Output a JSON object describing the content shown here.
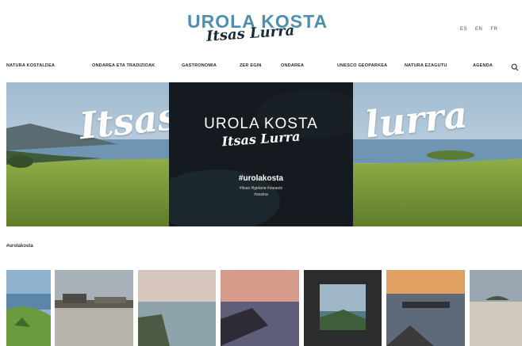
{
  "header": {
    "logo_main": "UROLA KOSTA",
    "logo_script": "Itsas Lurra",
    "languages": [
      "ES",
      "EN",
      "FR"
    ]
  },
  "nav": {
    "items": [
      "NATURA KOSTALDEA",
      "ONDAREA ETA TRADIZIOAK",
      "GASTRONOMIA",
      "ZER EGIN",
      "ONDAREA",
      "UNESCO GEOPARKEA",
      "NATURA EZAGUTU",
      "AGENDA"
    ]
  },
  "hero": {
    "word_left": "Itsas",
    "word_right": "lurra",
    "card_title": "UROLA KOSTA",
    "card_script": "Itsas Lurra",
    "hashtag": "#urolakosta",
    "tags_line1": "#itsas #lgetaria #zarautz",
    "tags_line2": "#zestoa"
  },
  "section": {
    "label": "#urolakosta"
  },
  "colors": {
    "brand_blue": "#4d8fb0",
    "dark_card": "#151b21",
    "sky": "#b9cfe0",
    "grass": "#7a9a3a"
  },
  "photos": [
    {
      "name": "photo-coast-green",
      "desc_icon": "image"
    },
    {
      "name": "photo-harbor-reflection",
      "desc_icon": "image"
    },
    {
      "name": "photo-sea-rocks",
      "desc_icon": "image"
    },
    {
      "name": "photo-sunset-cliffs",
      "desc_icon": "image"
    },
    {
      "name": "photo-window-view",
      "desc_icon": "image"
    },
    {
      "name": "photo-pier-sunset",
      "desc_icon": "image"
    },
    {
      "name": "photo-beach-island",
      "desc_icon": "image"
    }
  ]
}
